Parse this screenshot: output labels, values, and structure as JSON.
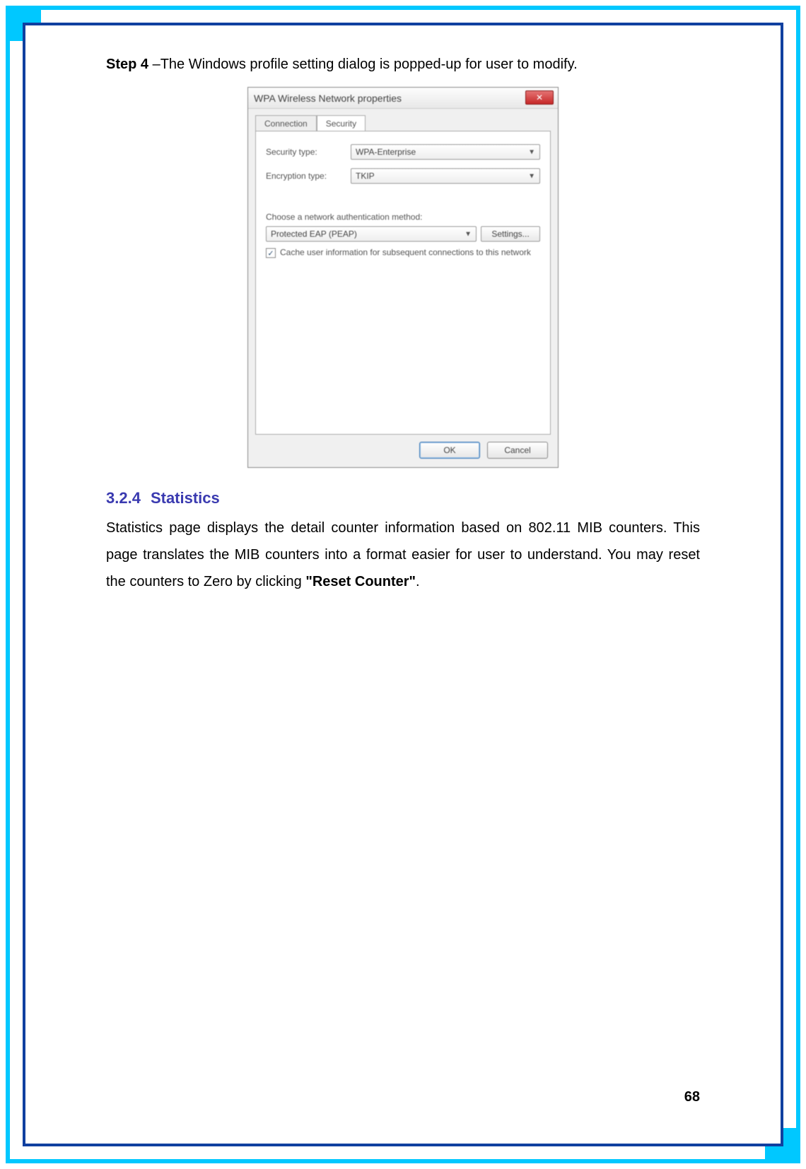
{
  "step": {
    "label": "Step 4",
    "text": " –The Windows profile setting dialog is popped-up for user to modify."
  },
  "dialog": {
    "title": "WPA Wireless Network properties",
    "close_glyph": "✕",
    "tabs": {
      "connection": "Connection",
      "security": "Security"
    },
    "security_type_label": "Security type:",
    "security_type_value": "WPA-Enterprise",
    "encryption_type_label": "Encryption type:",
    "encryption_type_value": "TKIP",
    "auth_method_label": "Choose a network authentication method:",
    "auth_method_value": "Protected EAP (PEAP)",
    "settings_label": "Settings...",
    "cache_checkbox_label": "Cache user information for subsequent connections to this network",
    "check_glyph": "✓",
    "ok_label": "OK",
    "cancel_label": "Cancel"
  },
  "section": {
    "number": "3.2.4",
    "title": "Statistics",
    "body_before": "Statistics page displays the detail counter information based on 802.11 MIB counters. This page translates the MIB counters into a format easier for user to understand. You may reset the counters to Zero by clicking ",
    "reset_bold": "\"Reset Counter\"",
    "body_after": "."
  },
  "page_number": "68"
}
